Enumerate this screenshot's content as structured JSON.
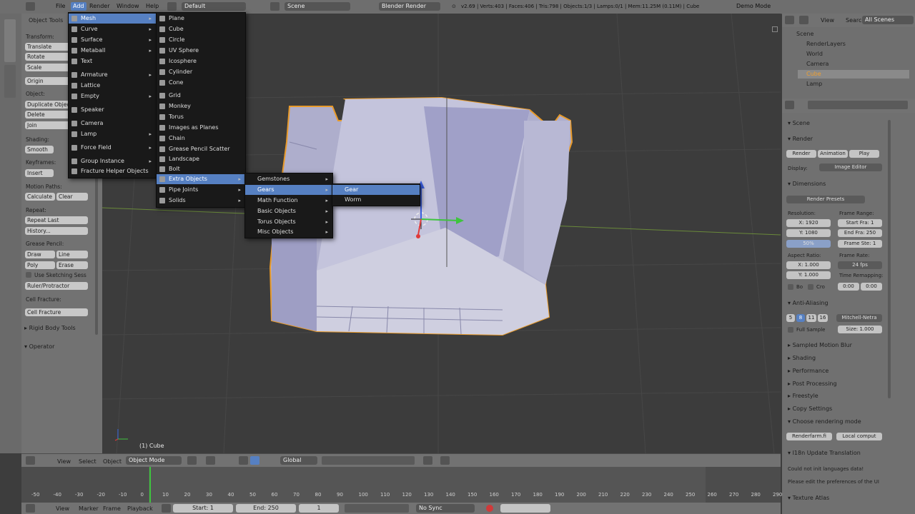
{
  "topbar": {
    "menus": [
      "File",
      "Add",
      "Render",
      "Window",
      "Help"
    ],
    "layout": "Default",
    "scene": "Scene",
    "engine": "Blender Render",
    "stats": "v2.69 | Verts:403 | Faces:406 | Tris:798 | Objects:1/3 | Lamps:0/1 | Mem:11.25M (0.11M) | Cube",
    "right": "Demo Mode"
  },
  "toolshelf": {
    "title": "Object Tools",
    "transform_label": "Transform:",
    "translate": "Translate",
    "rotate": "Rotate",
    "scale": "Scale",
    "origin": "Origin",
    "object_label": "Object:",
    "duplicate": "Duplicate Objects",
    "delete": "Delete",
    "join": "Join",
    "shading_label": "Shading:",
    "smooth": "Smooth",
    "keyframes_label": "Keyframes:",
    "insert": "Insert",
    "motion_label": "Motion Paths:",
    "calculate": "Calculate",
    "clear": "Clear",
    "repeat_label": "Repeat:",
    "repeat_last": "Repeat Last",
    "history": "History...",
    "grease_label": "Grease Pencil:",
    "draw": "Draw",
    "line": "Line",
    "poly": "Poly",
    "erase": "Erase",
    "sketch": "Use Sketching Sess",
    "ruler": "Ruler/Protractor",
    "cellfrac_label": "Cell Fracture:",
    "cellfrac_btn": "Cell Fracture",
    "rigid": "Rigid Body Tools",
    "operator": "Operator"
  },
  "menu_add": [
    {
      "label": "Mesh",
      "selected": true
    },
    {
      "label": "Curve"
    },
    {
      "label": "Surface"
    },
    {
      "label": "Metaball"
    },
    {
      "label": "Text"
    },
    {
      "label": "Armature"
    },
    {
      "label": "Lattice"
    },
    {
      "label": "Empty"
    },
    {
      "label": "Speaker"
    },
    {
      "label": "Camera"
    },
    {
      "label": "Lamp"
    },
    {
      "label": "Force Field"
    },
    {
      "label": "Group Instance"
    },
    {
      "label": "Fracture Helper Objects"
    }
  ],
  "menu_mesh": [
    {
      "label": "Plane"
    },
    {
      "label": "Cube"
    },
    {
      "label": "Circle"
    },
    {
      "label": "UV Sphere"
    },
    {
      "label": "Icosphere"
    },
    {
      "label": "Cylinder"
    },
    {
      "label": "Cone"
    },
    {
      "label": "Grid"
    },
    {
      "label": "Monkey"
    },
    {
      "label": "Torus"
    },
    {
      "label": "Images as Planes"
    },
    {
      "label": "Chain"
    },
    {
      "label": "Grease Pencil Scatter"
    },
    {
      "label": "Landscape"
    },
    {
      "label": "Bolt"
    },
    {
      "label": "Extra Objects",
      "selected": true
    },
    {
      "label": "Pipe Joints"
    },
    {
      "label": "Solids"
    }
  ],
  "menu_extra": [
    {
      "label": "Gemstones"
    },
    {
      "label": "Gears",
      "selected": true
    },
    {
      "label": "Math Function"
    },
    {
      "label": "Basic Objects"
    },
    {
      "label": "Torus Objects"
    },
    {
      "label": "Misc Objects"
    }
  ],
  "menu_gears": [
    {
      "label": "Gear",
      "selected": true
    },
    {
      "label": "Worm"
    }
  ],
  "viewport": {
    "object_label": "(1) Cube"
  },
  "vp_header": {
    "view": "View",
    "select": "Select",
    "object": "Object",
    "mode": "Object Mode",
    "orientation": "Global"
  },
  "timeline": {
    "ticks": [
      "-50",
      "-40",
      "-30",
      "-20",
      "-10",
      "0",
      "10",
      "20",
      "30",
      "40",
      "50",
      "60",
      "70",
      "80",
      "90",
      "100",
      "110",
      "120",
      "130",
      "140",
      "150",
      "160",
      "170",
      "180",
      "190",
      "200",
      "210",
      "220",
      "230",
      "240",
      "250",
      "260",
      "270",
      "280",
      "290"
    ],
    "view": "View",
    "marker": "Marker",
    "frame": "Frame",
    "playback": "Playback",
    "start": "Start: 1",
    "end": "End: 250",
    "current": "1",
    "sync": "No Sync"
  },
  "outliner": {
    "view": "View",
    "search": "Search",
    "filter": "All Scenes",
    "items": [
      "Scene",
      "RenderLayers",
      "World",
      "Camera",
      "Cube",
      "Lamp"
    ]
  },
  "properties": {
    "scene_label": "Scene",
    "render_section": "Render",
    "render_btn": "Render",
    "animation_btn": "Animation",
    "play_btn": "Play",
    "display_label": "Display:",
    "display_value": "Image Editor",
    "dimensions": "Dimensions",
    "presets": "Render Presets",
    "resolution_label": "Resolution:",
    "res_x": "X: 1920",
    "res_y": "Y: 1080",
    "res_pct": "50%",
    "frame_range_label": "Frame Range:",
    "start_frame": "Start Fra: 1",
    "end_frame": "End Fra: 250",
    "frame_step": "Frame Ste: 1",
    "aspect_label": "Aspect Ratio:",
    "asp_x": "X: 1.000",
    "asp_y": "Y: 1.000",
    "frame_rate_label": "Frame Rate:",
    "fps": "24 fps",
    "time_remap_label": "Time Remapping:",
    "old": "0:00",
    "new": "0:00",
    "border": "Bo",
    "crop": "Cro",
    "aa": "Anti-Aliasing",
    "aa_samples": [
      "5",
      "8",
      "11",
      "16"
    ],
    "aa_filter": "Mitchell-Netra",
    "full_sample": "Full Sample",
    "size": "Size: 1.000",
    "motion_blur": "Sampled Motion Blur",
    "shading": "Shading",
    "performance": "Performance",
    "post": "Post Processing",
    "freestyle": "Freestyle",
    "copy_settings": "Copy Settings",
    "choose_mode": "Choose rendering mode",
    "renderfarm": "Renderfarm.fi",
    "local": "Local comput",
    "i18n": "I18n Update Translation",
    "i18n_msg1": "Could not init languages data!",
    "i18n_msg2": "Please edit the preferences of the UI",
    "texture_atlas": "Texture Atlas"
  }
}
